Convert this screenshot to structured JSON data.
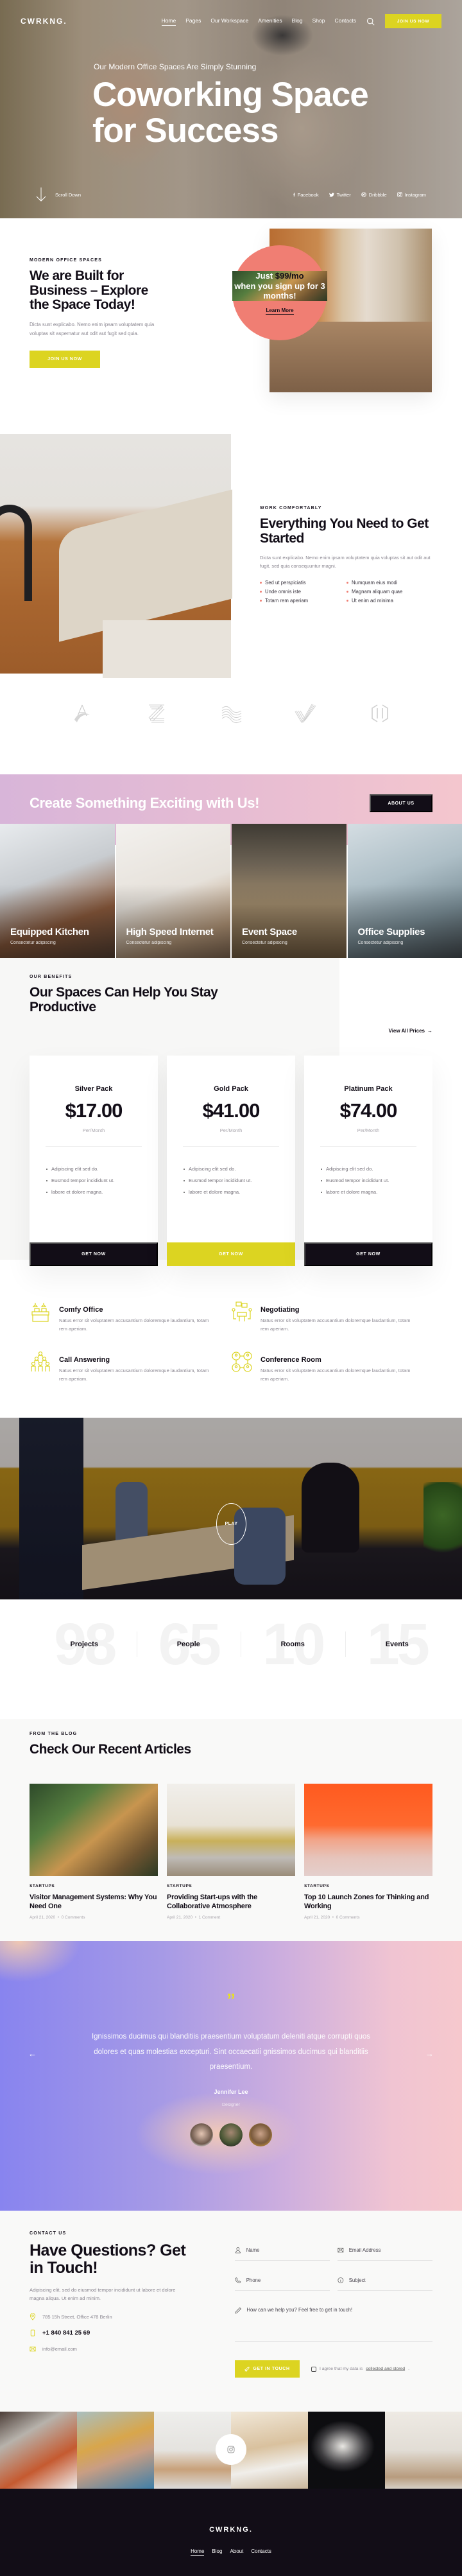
{
  "header": {
    "logo": "CWRKNG.",
    "nav": [
      {
        "label": "Home",
        "active": true
      },
      {
        "label": "Pages"
      },
      {
        "label": "Our Workspace"
      },
      {
        "label": "Amenities"
      },
      {
        "label": "Blog"
      },
      {
        "label": "Shop"
      },
      {
        "label": "Contacts"
      }
    ],
    "search_icon": "search-icon",
    "cta_label": "JOIN US NOW"
  },
  "hero": {
    "subtitle": "Our Modern Office Spaces Are Simply Stunning",
    "title": "Coworking Space for Success",
    "scroll_label": "Scroll Down",
    "socials": [
      {
        "icon": "facebook-icon",
        "label": "Facebook"
      },
      {
        "icon": "twitter-icon",
        "label": "Twitter"
      },
      {
        "icon": "dribbble-icon",
        "label": "Dribbble"
      },
      {
        "icon": "instagram-icon",
        "label": "Instagram"
      }
    ]
  },
  "about": {
    "eyebrow": "MODERN OFFICE SPACES",
    "title": "We are Built for Business – Explore the Space Today!",
    "text": "Dicta sunt explicabo. Nemo enim ipsam voluptatem quia voluptas sit aspernatur aut odit aut fugit sed quia.",
    "button": "JOIN US NOW",
    "promo": {
      "line1_pre": "Just ",
      "line1_price": "$99/mo",
      "line2": "when you sign up for 3 months!",
      "link": "Learn More"
    }
  },
  "work": {
    "eyebrow": "WORK COMFORTABLY",
    "title": "Everything You Need to Get Started",
    "text": "Dicta sunt explicabo. Nemo enim ipsam voluptatem quia voluptas sit aut odit aut fugit, sed quia consequuntur magni.",
    "list": [
      "Sed ut perspiciatis",
      "Numquam eius modi",
      "Unde omnis iste",
      "Magnam aliquam quae",
      "Totam rem aperiam",
      "Ut enim ad minima"
    ]
  },
  "partners": [
    "partner-logo-a",
    "partner-logo-z",
    "partner-logo-wave",
    "partner-logo-check",
    "partner-logo-hex"
  ],
  "cta": {
    "title": "Create Something Exciting with Us!",
    "button": "ABOUT US"
  },
  "amenities": [
    {
      "title": "Equipped Kitchen",
      "subtitle": "Consectetur adipiscing"
    },
    {
      "title": "High Speed Internet",
      "subtitle": "Consectetur adipiscing"
    },
    {
      "title": "Event Space",
      "subtitle": "Consectetur adipiscing"
    },
    {
      "title": "Office Supplies",
      "subtitle": "Consectetur adipiscing"
    }
  ],
  "pricing": {
    "eyebrow": "OUR BENEFITS",
    "title": "Our Spaces Can Help You Stay Productive",
    "view_all": "View All Prices",
    "plans": [
      {
        "name": "Silver Pack",
        "price": "$17.00",
        "period": "Per/Month",
        "features": [
          "Adipiscing elit sed do.",
          "Eusmod tempor incididunt ut.",
          "labore et dolore magna."
        ],
        "button": "GET NOW",
        "highlight": false
      },
      {
        "name": "Gold Pack",
        "price": "$41.00",
        "period": "Per/Month",
        "features": [
          "Adipiscing elit sed do.",
          "Eusmod tempor incididunt ut.",
          "labore et dolore magna."
        ],
        "button": "GET NOW",
        "highlight": true
      },
      {
        "name": "Platinum Pack",
        "price": "$74.00",
        "period": "Per/Month",
        "features": [
          "Adipiscing elit sed do.",
          "Eusmod tempor incididunt ut.",
          "labore et dolore magna."
        ],
        "button": "GET NOW",
        "highlight": false
      }
    ]
  },
  "features": [
    {
      "icon": "office-desk-icon",
      "title": "Comfy Office",
      "text": "Natus error sit voluptatem accusantium doloremque laudantium, totam rem aperiam."
    },
    {
      "icon": "negotiation-icon",
      "title": "Negotiating",
      "text": "Natus error sit voluptatem accusantium doloremque laudantium, totam rem aperiam."
    },
    {
      "icon": "team-icon",
      "title": "Call Answering",
      "text": "Natus error sit voluptatem accusantium doloremque laudantium, totam rem aperiam."
    },
    {
      "icon": "conference-icon",
      "title": "Conference Room",
      "text": "Natus error sit voluptatem accusantium doloremque laudantium, totam rem aperiam."
    }
  ],
  "video": {
    "play_label": "PLAY"
  },
  "stats": [
    {
      "number": "98",
      "label": "Projects"
    },
    {
      "number": "65",
      "label": "People"
    },
    {
      "number": "10",
      "label": "Rooms"
    },
    {
      "number": "15",
      "label": "Events"
    }
  ],
  "blog": {
    "eyebrow": "FROM THE BLOG",
    "title": "Check Our Recent Articles",
    "posts": [
      {
        "category": "STARTUPS",
        "title": "Visitor Management Systems: Why You Need One",
        "date": "April 21, 2020",
        "comments": "0 Comments"
      },
      {
        "category": "STARTUPS",
        "title": "Providing Start-ups with the Collaborative Atmosphere",
        "date": "April 21, 2020",
        "comments": "1 Comment"
      },
      {
        "category": "STARTUPS",
        "title": "Top 10 Launch Zones for Thinking and Working",
        "date": "April 21, 2020",
        "comments": "0 Comments"
      }
    ]
  },
  "testimonial": {
    "quote": "Ignissimos ducimus qui blanditiis praesentium voluptatum deleniti atque corrupti quos dolores et quas molestias excepturi. Sint occaecatii gnissimos ducimus qui blanditiis praesentium.",
    "name": "Jennifer Lee",
    "role": "Designer"
  },
  "contact": {
    "eyebrow": "CONTACT US",
    "title": "Have Questions? Get in Touch!",
    "text": "Adipiscing elit, sed do eiusmod tempor incididunt ut labore et dolore magna aliqua. Ut enim ad minim.",
    "address": "785 15h Street, Office 478 Berlin",
    "phone": "+1 840 841 25 69",
    "email": "info@email.com",
    "form": {
      "name_placeholder": "Name",
      "email_placeholder": "Email Address",
      "phone_placeholder": "Phone",
      "subject_placeholder": "Subject",
      "message_placeholder": "How can we help you? Feel free to get in touch!",
      "submit": "GET IN TOUCH",
      "agree_pre": "I agree that my data is ",
      "agree_link": "collected and stored",
      "agree_post": "."
    }
  },
  "footer": {
    "logo": "CWRKNG.",
    "links": [
      {
        "label": "Home",
        "active": true
      },
      {
        "label": "Blog"
      },
      {
        "label": "About"
      },
      {
        "label": "Contacts"
      }
    ]
  },
  "colors": {
    "accent": "#dcd421",
    "dark": "#120d17",
    "coral": "#f07e73"
  }
}
